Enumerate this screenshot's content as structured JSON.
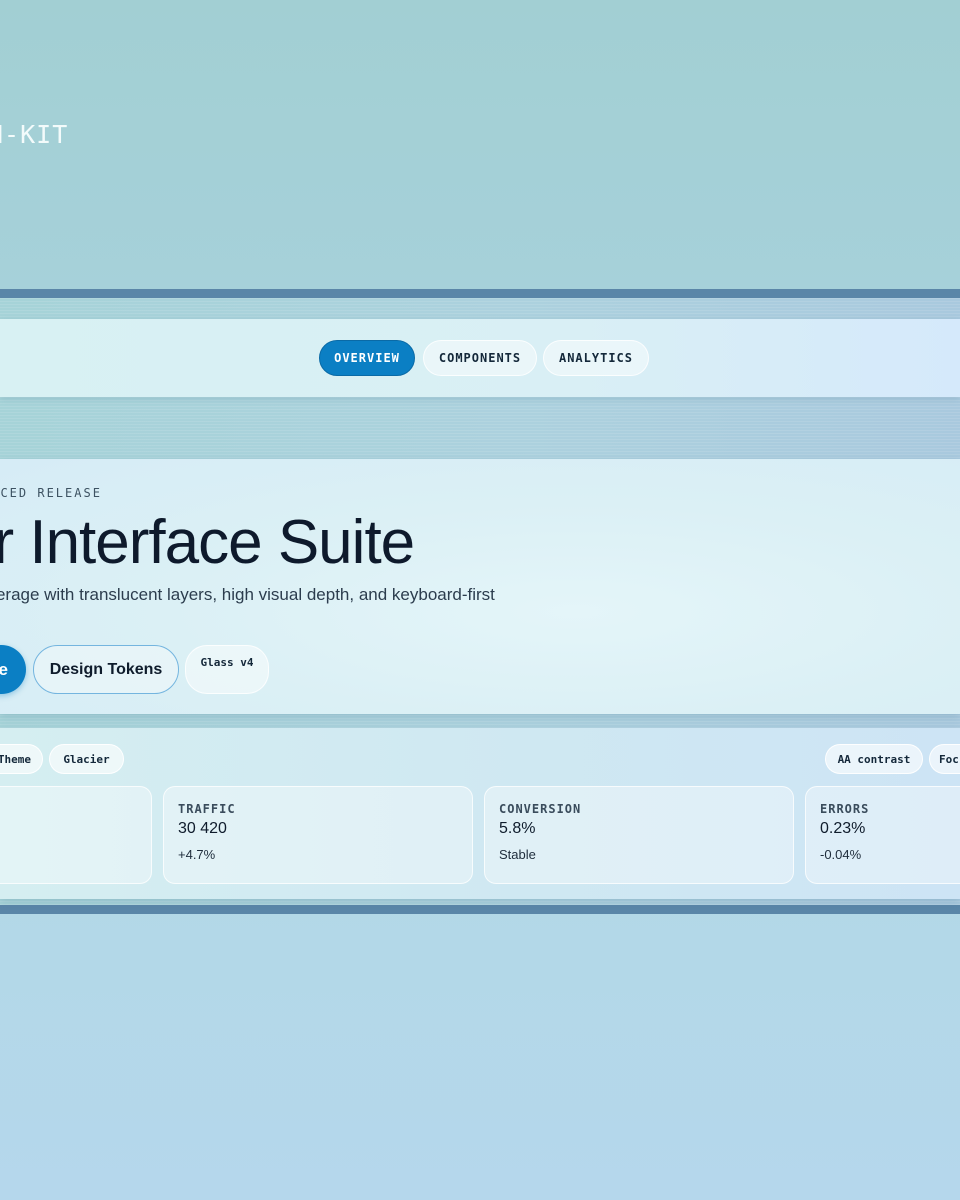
{
  "brand": {
    "text": "N-KIT"
  },
  "nav": {
    "tabs": [
      {
        "label": "OVERVIEW",
        "active": true
      },
      {
        "label": "COMPONENTS",
        "active": false
      },
      {
        "label": "ANALYTICS",
        "active": false
      }
    ]
  },
  "hero": {
    "eyebrow": "ANCED RELEASE",
    "title": "er Interface Suite",
    "subtitle": "overage with translucent layers, high visual depth, and keyboard-first",
    "primary_button": "e",
    "secondary_button": "Design Tokens",
    "badge": "Glass v4"
  },
  "metrics": {
    "chips_left": [
      "Theme",
      "Glacier"
    ],
    "chips_right": [
      "AA contrast",
      "Foc"
    ],
    "cards": [
      {
        "label": "TRAFFIC",
        "value": "30 420",
        "delta": "+4.7%"
      },
      {
        "label": "CONVERSION",
        "value": "5.8%",
        "delta": "Stable"
      },
      {
        "label": "ERRORS",
        "value": "0.23%",
        "delta": "-0.04%"
      }
    ]
  },
  "colors": {
    "accent": "#0b7fc4",
    "band_border": "#5a86a8",
    "text_dark": "#0e1a2c"
  }
}
